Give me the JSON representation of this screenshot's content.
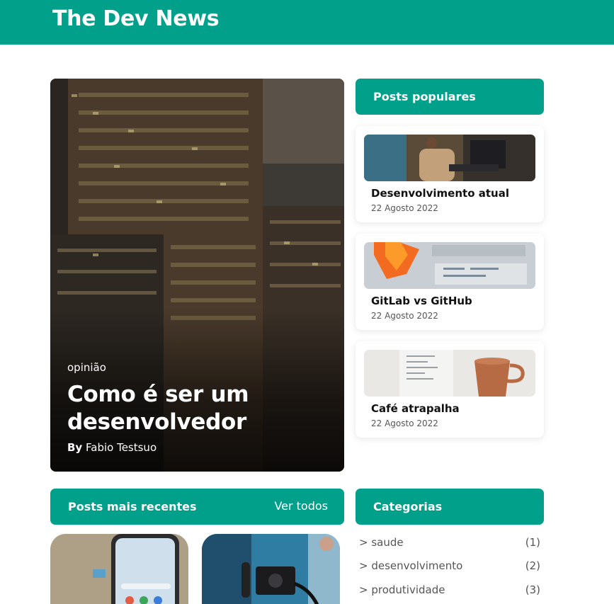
{
  "header": {
    "brand": "The Dev News"
  },
  "featured": {
    "category": "opinião",
    "title": "Como é ser um desenvolvedor",
    "byline_prefix": "By",
    "author": "Fabio Testsuo",
    "image_icon": "city-skyline-photo"
  },
  "popular": {
    "heading": "Posts populares",
    "posts": [
      {
        "title": "Desenvolvimento atual",
        "date": "22 Agosto 2022",
        "image_icon": "person-at-laptop-photo"
      },
      {
        "title": "GitLab vs GitHub",
        "date": "22 Agosto 2022",
        "image_icon": "gitlab-logo-photo"
      },
      {
        "title": "Café atrapalha",
        "date": "22 Agosto 2022",
        "image_icon": "coffee-cup-photo"
      }
    ]
  },
  "recent": {
    "heading": "Posts mais recentes",
    "see_all": "Ver todos",
    "posts": [
      {
        "image_icon": "smartphone-photo"
      },
      {
        "image_icon": "camera-gimbal-photo"
      }
    ]
  },
  "categories": {
    "heading": "Categorias",
    "items": [
      {
        "name": "> saude",
        "count": "(1)"
      },
      {
        "name": "> desenvolvimento",
        "count": "(2)"
      },
      {
        "name": "> produtividade",
        "count": "(3)"
      }
    ]
  },
  "colors": {
    "accent": "#00a08a",
    "text": "#111111",
    "muted": "#555555"
  }
}
